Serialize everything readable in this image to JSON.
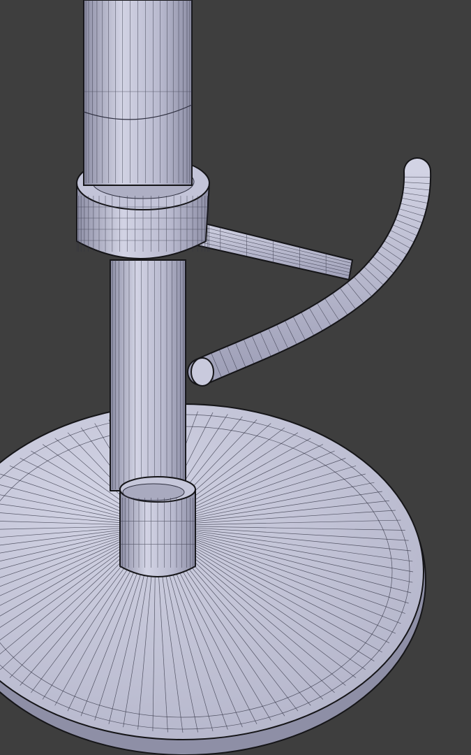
{
  "scene": {
    "subject": "bar-stool-wireframe-render",
    "colors": {
      "background": "#3e3e3e",
      "surface": "#b9bacf",
      "surface_light": "#d2d3e4",
      "surface_dark": "#8e8fa6",
      "wire": "#2f3040",
      "outline": "#151518"
    }
  }
}
